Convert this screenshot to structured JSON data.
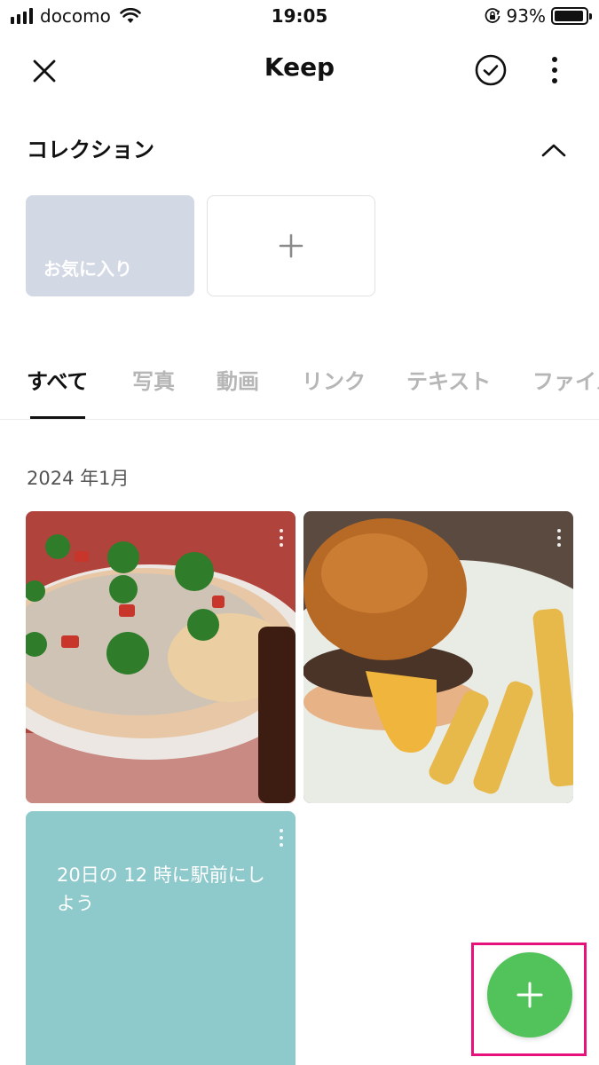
{
  "status_bar": {
    "carrier": "docomo",
    "time": "19:05",
    "battery_percent": "93%",
    "battery_level": 0.93,
    "icons": [
      "signal-icon",
      "wifi-icon",
      "orientation-lock-icon",
      "battery-icon"
    ]
  },
  "header": {
    "title": "Keep",
    "icons": [
      "close-icon",
      "check-circle-icon",
      "more-vertical-icon"
    ]
  },
  "collection": {
    "title": "コレクション",
    "toggle_icon": "chevron-up-icon",
    "cards": [
      {
        "label": "お気に入り",
        "color": "#d3d8e5"
      },
      {
        "label": "",
        "icon": "plus-icon"
      }
    ]
  },
  "tabs": {
    "items": [
      {
        "label": "すべて",
        "active": true
      },
      {
        "label": "写真",
        "active": false
      },
      {
        "label": "動画",
        "active": false
      },
      {
        "label": "リンク",
        "active": false
      },
      {
        "label": "テキスト",
        "active": false
      },
      {
        "label": "ファイル",
        "active": false
      }
    ]
  },
  "content": {
    "date_label": "2024 年1月",
    "items": [
      {
        "type": "photo",
        "icon": "more-vertical-icon"
      },
      {
        "type": "photo",
        "icon": "more-vertical-icon"
      },
      {
        "type": "text",
        "text": "20日の 12 時に駅前にしよう",
        "color": "#8ec9cb",
        "icon": "more-vertical-icon"
      }
    ]
  },
  "fab": {
    "icon": "plus-icon",
    "color": "#52c35b",
    "highlight_color": "#e6117a"
  }
}
